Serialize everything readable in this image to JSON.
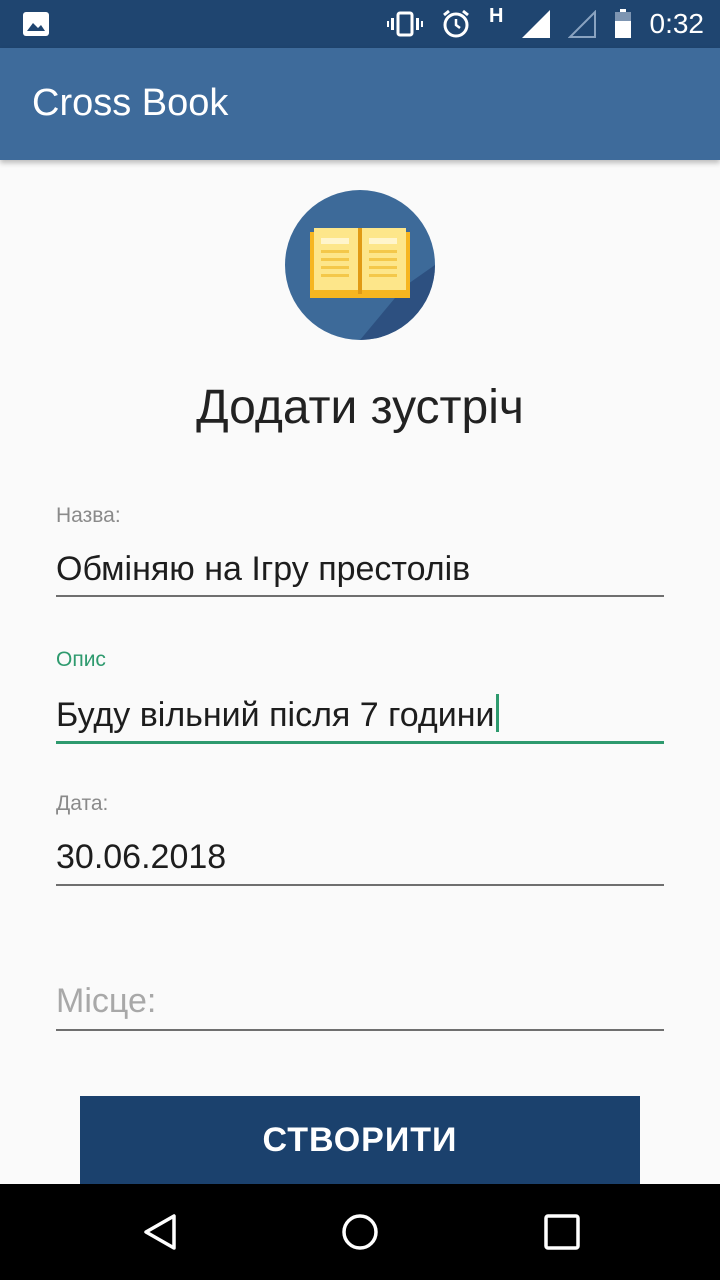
{
  "status_bar": {
    "time": "0:32",
    "network_letter": "H",
    "icons": [
      "image-icon",
      "vibrate-icon",
      "alarm-icon",
      "signal-icon",
      "signal-empty-icon",
      "battery-icon"
    ]
  },
  "app_bar": {
    "title": "Cross Book"
  },
  "page": {
    "title": "Додати зустріч",
    "logo_icon": "open-book-icon"
  },
  "form": {
    "name": {
      "label": "Назва:",
      "value": "Обміняю на Ігру престолів"
    },
    "description": {
      "label": "Опис",
      "value": "Буду вільний після 7 години"
    },
    "date": {
      "label": "Дата:",
      "value": "30.06.2018"
    },
    "place": {
      "placeholder": "Місце:"
    }
  },
  "create_button": {
    "label": "СТВОРИТИ"
  },
  "nav_bar": {
    "icons": [
      "back-icon",
      "home-icon",
      "recents-icon"
    ]
  },
  "colors": {
    "status_bar": "#1f4570",
    "app_bar": "#3e6b9b",
    "accent": "#2e9a6e",
    "button": "#1b416d"
  }
}
